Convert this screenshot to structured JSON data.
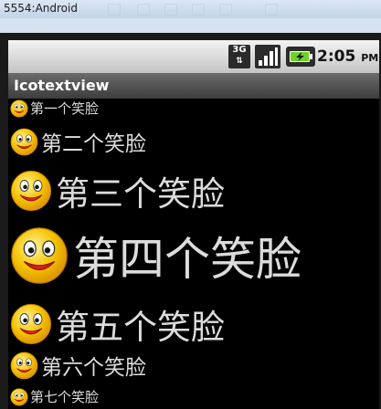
{
  "window": {
    "title": "5554:Android"
  },
  "statusbar": {
    "network": "3G",
    "time": "2:05",
    "ampm": "PM"
  },
  "app": {
    "title": "Icotextview"
  },
  "rows": [
    {
      "label": "第一个笑脸",
      "icon": "smiley-face-icon"
    },
    {
      "label": "第二个笑脸",
      "icon": "smiley-face-icon"
    },
    {
      "label": "第三个笑脸",
      "icon": "smiley-face-icon"
    },
    {
      "label": "第四个笑脸",
      "icon": "smiley-face-icon"
    },
    {
      "label": "第五个笑脸",
      "icon": "smiley-face-icon"
    },
    {
      "label": "第六个笑脸",
      "icon": "smiley-face-icon"
    },
    {
      "label": "第七个笑脸",
      "icon": "smiley-face-icon"
    }
  ],
  "colors": {
    "text": "#dcdcdc",
    "background": "#000000",
    "smiley": "#f5c400"
  }
}
